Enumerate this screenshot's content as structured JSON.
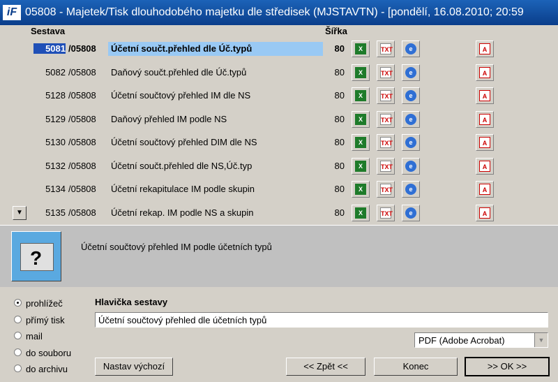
{
  "window": {
    "title": "05808 - Majetek/Tisk dlouhodobého majetku dle středisek (MJSTAVTN) - [pondělí, 16.08.2010; 20:59",
    "logo": "iF"
  },
  "list": {
    "col_sestava": "Sestava",
    "col_sirka": "Šířka",
    "rows": [
      {
        "num": "5081",
        "doc": "/05808",
        "name": "Účetní součt.přehled dle Úč.typů",
        "width": "80",
        "selected": true
      },
      {
        "num": "5082",
        "doc": "/05808",
        "name": "Daňový součt.přehled dle Úč.typů",
        "width": "80"
      },
      {
        "num": "5128",
        "doc": "/05808",
        "name": "Účetní součtový přehled IM dle NS",
        "width": "80"
      },
      {
        "num": "5129",
        "doc": "/05808",
        "name": "Daňový přehled IM podle NS",
        "width": "80"
      },
      {
        "num": "5130",
        "doc": "/05808",
        "name": "Účetní součtový přehled DIM dle NS",
        "width": "80"
      },
      {
        "num": "5132",
        "doc": "/05808",
        "name": "Účetní součt.přehled dle NS,Úč.typ",
        "width": "80"
      },
      {
        "num": "5134",
        "doc": "/05808",
        "name": "Účetní rekapitulace IM podle skupin",
        "width": "80"
      },
      {
        "num": "5135",
        "doc": "/05808",
        "name": "Účetní rekap. IM podle NS a skupin",
        "width": "80"
      }
    ],
    "icons": {
      "xls": "X",
      "txt": "TXT",
      "web": "e",
      "pdf": "A"
    },
    "scroll_glyph": "▼"
  },
  "description": "Účetní součtový přehled IM podle účetních typů",
  "output": {
    "options": [
      "prohlížeč",
      "přímý tisk",
      "mail",
      "do souboru",
      "do archivu"
    ],
    "selected": 0
  },
  "header": {
    "label": "Hlavička sestavy",
    "value": "Účetní součtový přehled dle účetních typů"
  },
  "format": {
    "selected": "PDF (Adobe Acrobat)",
    "arrow": "▼"
  },
  "buttons": {
    "defaults": "Nastav výchozí",
    "back": "<< Zpět <<",
    "end": "Konec",
    "ok": ">> OK >>"
  },
  "colors": {
    "title_bar": "#0a3d8a",
    "selection": "#1f4fb7",
    "row_highlight": "#99c9f4",
    "description_panel": "#c0c0c0"
  }
}
